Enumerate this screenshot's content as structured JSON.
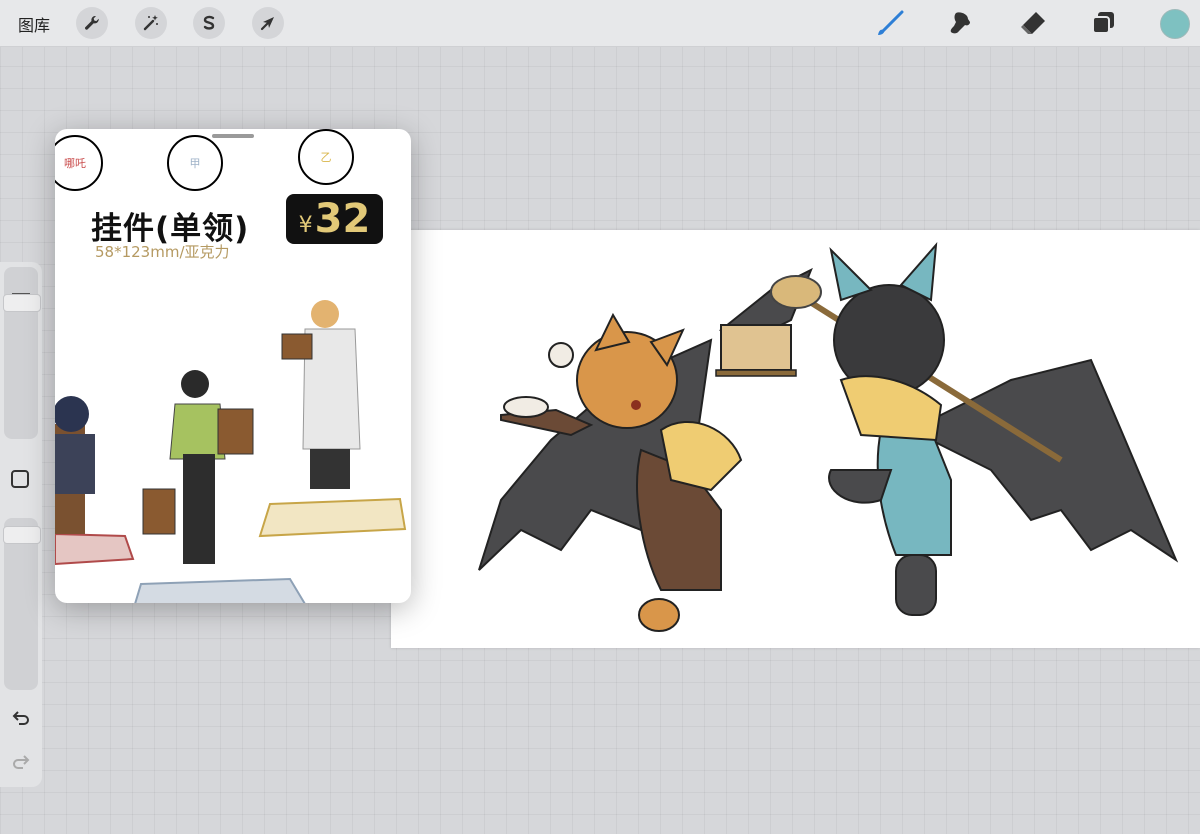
{
  "toolbar": {
    "gallery_label": "图库",
    "left_tools": [
      "wrench-icon",
      "magic-wand-icon",
      "selection-icon",
      "transform-arrow-icon"
    ],
    "right_tools": [
      "brush-icon",
      "smudge-icon",
      "eraser-icon",
      "layers-icon"
    ],
    "active_tool": "brush-icon",
    "active_color": "#7ec1c1",
    "brush_color": "#2e7fd6"
  },
  "sidebar": {
    "size_slider_level": 0.15,
    "opacity_slider_level": 0.05,
    "undo_icon": "undo-icon",
    "redo_icon": "redo-icon"
  },
  "reference": {
    "charms": [
      {
        "text": "哪吒",
        "color": "#c94b4b"
      },
      {
        "text": "甲",
        "color": "#9fb3c8"
      },
      {
        "text": "乙",
        "color": "#d9b64a"
      }
    ],
    "title": "挂件(单领)",
    "spec": "58*123mm/亚克力",
    "price_currency": "¥",
    "price_value": "32"
  }
}
